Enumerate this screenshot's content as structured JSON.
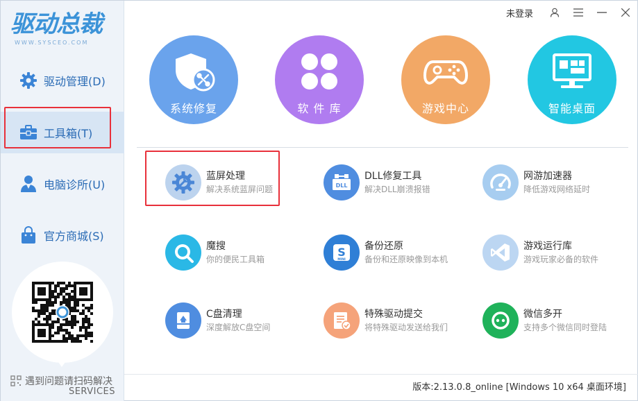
{
  "app": {
    "logo_title": "驱动总裁",
    "logo_sub": "WWW.SYSCEO.COM"
  },
  "titlebar": {
    "login_label": "未登录",
    "icons": [
      "user-icon",
      "menu-icon",
      "minimize-icon",
      "close-icon"
    ]
  },
  "sidebar": {
    "items": [
      {
        "label": "驱动管理(D)",
        "icon": "gear-icon",
        "active": false
      },
      {
        "label": "工具箱(T)",
        "icon": "toolbox-icon",
        "active": true
      },
      {
        "label": "电脑诊所(U)",
        "icon": "doctor-icon",
        "active": false
      },
      {
        "label": "官方商城(S)",
        "icon": "shopping-bag-icon",
        "active": false
      }
    ],
    "help_text": "遇到问题请扫码解决",
    "help_sub": "SERVICES"
  },
  "big_buttons": [
    {
      "label": "系统修复",
      "color": "#6aa3ec",
      "icon": "shield-repair-icon"
    },
    {
      "label": "软 件 库",
      "color": "#b07cf0",
      "icon": "clover-icon"
    },
    {
      "label": "游戏中心",
      "color": "#f2a866",
      "icon": "gamepad-icon"
    },
    {
      "label": "智能桌面",
      "color": "#22c7e2",
      "icon": "monitor-icon"
    }
  ],
  "tools": [
    {
      "title": "蓝屏处理",
      "desc": "解决系统蓝屏问题",
      "color": "#bcd3ee",
      "icon": "gear-wrench-icon"
    },
    {
      "title": "DLL修复工具",
      "desc": "解决DLL崩溃报错",
      "color": "#4f8de0",
      "icon": "dll-icon"
    },
    {
      "title": "网游加速器",
      "desc": "降低游戏网络延时",
      "color": "#a7cdf0",
      "icon": "speedometer-icon"
    },
    {
      "title": "魔搜",
      "desc": "你的便民工具箱",
      "color": "#2ab8e6",
      "icon": "search-icon"
    },
    {
      "title": "备份还原",
      "desc": "备份和还原映像到本机",
      "color": "#2f7fd6",
      "icon": "backup-icon"
    },
    {
      "title": "游戏运行库",
      "desc": "游戏玩家必备的软件",
      "color": "#bcd6f2",
      "icon": "visual-studio-icon"
    },
    {
      "title": "C盘清理",
      "desc": "深度解放C盘空间",
      "color": "#4f8de0",
      "icon": "disk-clean-icon"
    },
    {
      "title": "特殊驱动提交",
      "desc": "将特殊驱动发送给我们",
      "color": "#f5a37a",
      "icon": "document-check-icon"
    },
    {
      "title": "微信多开",
      "desc": "支持多个微信同时登陆",
      "color": "#1fb25a",
      "icon": "wechat-icon"
    }
  ],
  "footer": {
    "version": "版本:2.13.0.8_online [Windows 10 x64 桌面环境]"
  }
}
